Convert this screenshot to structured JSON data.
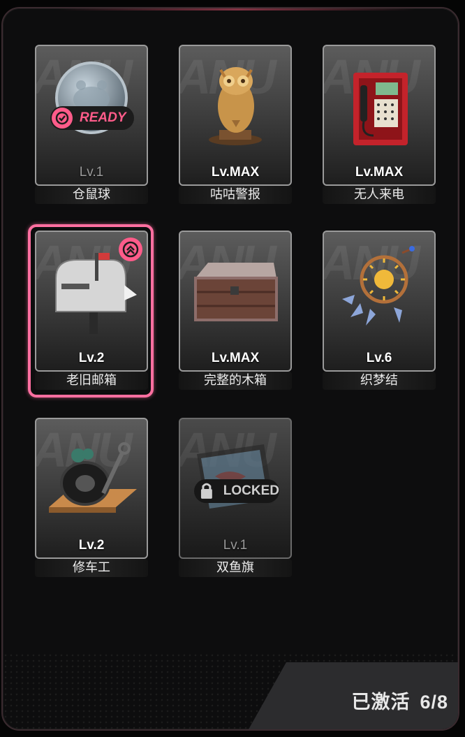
{
  "items": [
    {
      "name": "仓鼠球",
      "level": "Lv.1",
      "status": "ready",
      "status_label": "READY",
      "art": "hamster-ball-icon"
    },
    {
      "name": "咕咕警报",
      "level": "Lv.MAX",
      "status": "active",
      "art": "owl-statue-icon"
    },
    {
      "name": "无人来电",
      "level": "Lv.MAX",
      "status": "active",
      "art": "payphone-icon"
    },
    {
      "name": "老旧邮箱",
      "level": "Lv.2",
      "status": "upgradable",
      "selected": true,
      "art": "mailbox-icon"
    },
    {
      "name": "完整的木箱",
      "level": "Lv.MAX",
      "status": "active",
      "art": "wooden-crate-icon"
    },
    {
      "name": "织梦结",
      "level": "Lv.6",
      "status": "active",
      "art": "dreamcatcher-icon"
    },
    {
      "name": "修车工",
      "level": "Lv.2",
      "status": "active",
      "art": "tire-wrench-icon"
    },
    {
      "name": "双鱼旗",
      "level": "Lv.1",
      "status": "locked",
      "status_label": "LOCKED",
      "art": "pisces-flag-icon"
    }
  ],
  "footer": {
    "activated_label": "已激活",
    "activated_count": "6/8"
  },
  "colors": {
    "accent": "#ff5c8a",
    "selected_border": "#ff6fa0",
    "background": "#0d0d0e"
  }
}
